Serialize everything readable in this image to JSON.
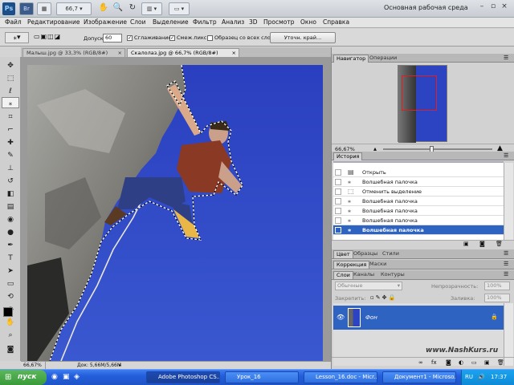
{
  "app": {
    "logo": "Ps",
    "bridge_label": "Br",
    "zoom_value": "66,7",
    "workspace_name": "Основная рабочая среда"
  },
  "menu": [
    "Файл",
    "Редактирование",
    "Изображение",
    "Слои",
    "Выделение",
    "Фильтр",
    "Анализ",
    "3D",
    "Просмотр",
    "Окно",
    "Справка"
  ],
  "options": {
    "tolerance_label": "Допуск:",
    "tolerance_value": "60",
    "antialias_label": "Сглаживание",
    "contiguous_label": "Смеж.пикс",
    "sample_all_label": "Образец со всех слоев",
    "refine_edge_label": "Уточн. край..."
  },
  "documents": {
    "tabs": [
      "Малыш.jpg @ 33,3% (RGB/8#)",
      "Скалолаз.jpg @ 66,7% (RGB/8#)"
    ],
    "zoom": "66,67%",
    "doc_size": "Док: 5,66M/5,66M"
  },
  "navigator": {
    "tabs": [
      "Навигатор",
      "Операции"
    ],
    "zoom": "66,67%"
  },
  "history": {
    "title": "История",
    "items": [
      "Открыть",
      "Волшебная палочка",
      "Отменить выделение",
      "Волшебная палочка",
      "Волшебная палочка",
      "Волшебная палочка",
      "Волшебная палочка"
    ]
  },
  "color_panel": {
    "tabs": [
      "Цвет",
      "Образцы",
      "Стили"
    ]
  },
  "correction_panel": {
    "tabs": [
      "Коррекция",
      "Маски"
    ]
  },
  "layers": {
    "tabs": [
      "Слои",
      "Каналы",
      "Контуры"
    ],
    "blend_mode": "Обычные",
    "opacity_label": "Непрозрачность:",
    "opacity_value": "100%",
    "lock_label": "Закрепить:",
    "fill_label": "Заливка:",
    "fill_value": "100%",
    "layer_name": "Фон"
  },
  "watermark": "www.NashKurs.ru",
  "taskbar": {
    "start_label": "пуск",
    "items": [
      "Adobe Photoshop CS...",
      "Урок_16",
      "Lesson_16.doc - Micr...",
      "Документ1 - Microso..."
    ],
    "lang": "RU",
    "time": "17:37"
  },
  "colors": {
    "sky": "#2e46c4",
    "selection": "#2f63c2",
    "taskbar": "#245edb"
  }
}
